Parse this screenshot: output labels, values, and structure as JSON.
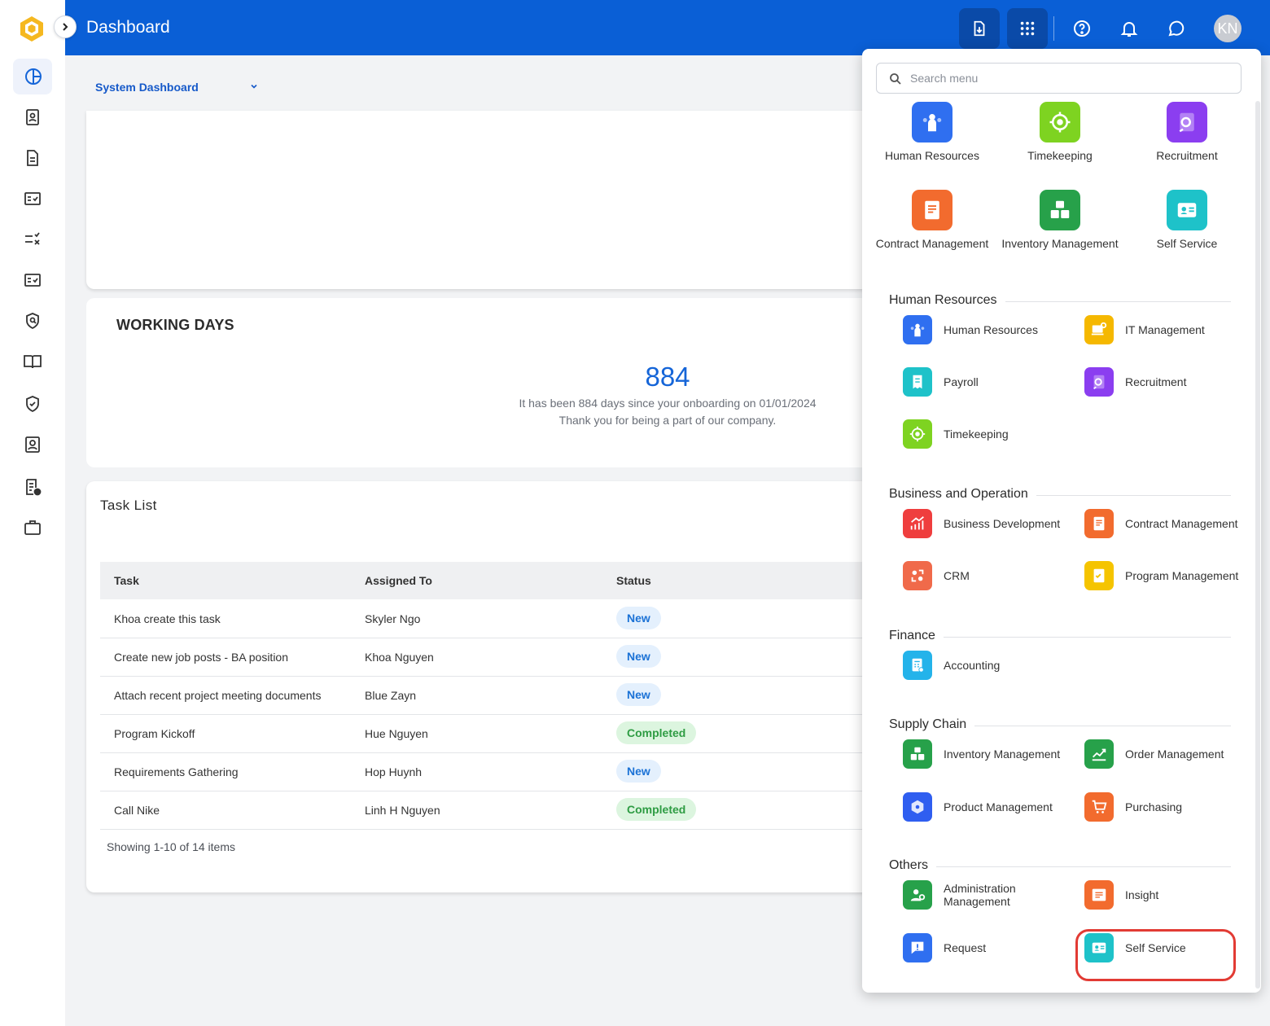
{
  "header": {
    "title": "Dashboard",
    "avatar_initials": "KN"
  },
  "dashboard_selector": {
    "value": "System Dashboard"
  },
  "working_days": {
    "title": "WORKING DAYS",
    "count": "884",
    "line1": "It has been 884 days since your onboarding on 01/01/2024",
    "line2": "Thank you for being a part of our company."
  },
  "task_list": {
    "title": "Task List",
    "columns": [
      "Task",
      "Assigned To",
      "Status"
    ],
    "rows": [
      {
        "task": "Khoa create this task",
        "assigned": "Skyler Ngo",
        "status": "New"
      },
      {
        "task": "Create new job posts - BA position",
        "assigned": "Khoa Nguyen",
        "status": "New"
      },
      {
        "task": "Attach recent project meeting documents",
        "assigned": "Blue Zayn",
        "status": "New"
      },
      {
        "task": "Program Kickoff",
        "assigned": "Hue Nguyen",
        "status": "Completed"
      },
      {
        "task": "Requirements Gathering",
        "assigned": "Hop Huynh",
        "status": "New"
      },
      {
        "task": "Call Nike",
        "assigned": "Linh H Nguyen",
        "status": "Completed"
      }
    ],
    "footer": "Showing 1-10 of 14 items"
  },
  "menu": {
    "search_placeholder": "Search menu",
    "favorites": [
      {
        "label": "Human Resources",
        "icon": "human-resources-icon",
        "color": "#2f6ff0"
      },
      {
        "label": "Timekeeping",
        "icon": "timekeeping-icon",
        "color": "#7ed321"
      },
      {
        "label": "Recruitment",
        "icon": "recruitment-icon",
        "color": "#8b3ef0"
      },
      {
        "label": "Contract Management",
        "icon": "contract-icon",
        "color": "#f26b2e"
      },
      {
        "label": "Inventory Management",
        "icon": "inventory-icon",
        "color": "#27a14a"
      },
      {
        "label": "Self Service",
        "icon": "self-service-icon",
        "color": "#1ec2c9"
      }
    ],
    "sections": [
      {
        "title": "Human Resources",
        "items": [
          {
            "label": "Human Resources",
            "icon": "human-resources-icon",
            "color": "#2f6ff0"
          },
          {
            "label": "IT Management",
            "icon": "it-management-icon",
            "color": "#f5b800"
          },
          {
            "label": "Payroll",
            "icon": "payroll-icon",
            "color": "#1ec2c9"
          },
          {
            "label": "Recruitment",
            "icon": "recruitment-icon",
            "color": "#8b3ef0"
          },
          {
            "label": "Timekeeping",
            "icon": "timekeeping-icon",
            "color": "#7ed321"
          }
        ]
      },
      {
        "title": "Business and Operation",
        "items": [
          {
            "label": "Business Development",
            "icon": "business-development-icon",
            "color": "#ef3e3e"
          },
          {
            "label": "Contract Management",
            "icon": "contract-icon",
            "color": "#f26b2e"
          },
          {
            "label": "CRM",
            "icon": "crm-icon",
            "color": "#f06a4a"
          },
          {
            "label": "Program Management",
            "icon": "program-management-icon",
            "color": "#f5c400"
          }
        ]
      },
      {
        "title": "Finance",
        "items": [
          {
            "label": "Accounting",
            "icon": "accounting-icon",
            "color": "#24b3ea"
          }
        ]
      },
      {
        "title": "Supply Chain",
        "items": [
          {
            "label": "Inventory Management",
            "icon": "inventory-icon",
            "color": "#27a14a"
          },
          {
            "label": "Order Management",
            "icon": "order-management-icon",
            "color": "#27a14a"
          },
          {
            "label": "Product Management",
            "icon": "product-management-icon",
            "color": "#2f5ef0"
          },
          {
            "label": "Purchasing",
            "icon": "purchasing-icon",
            "color": "#f26b2e"
          }
        ]
      },
      {
        "title": "Others",
        "items": [
          {
            "label": "Administration Management",
            "icon": "administration-icon",
            "color": "#27a14a"
          },
          {
            "label": "Insight",
            "icon": "insight-icon",
            "color": "#f26b2e"
          },
          {
            "label": "Request",
            "icon": "request-icon",
            "color": "#2f6ff0"
          },
          {
            "label": "Self Service",
            "icon": "self-service-icon",
            "color": "#1ec2c9"
          }
        ]
      }
    ]
  }
}
